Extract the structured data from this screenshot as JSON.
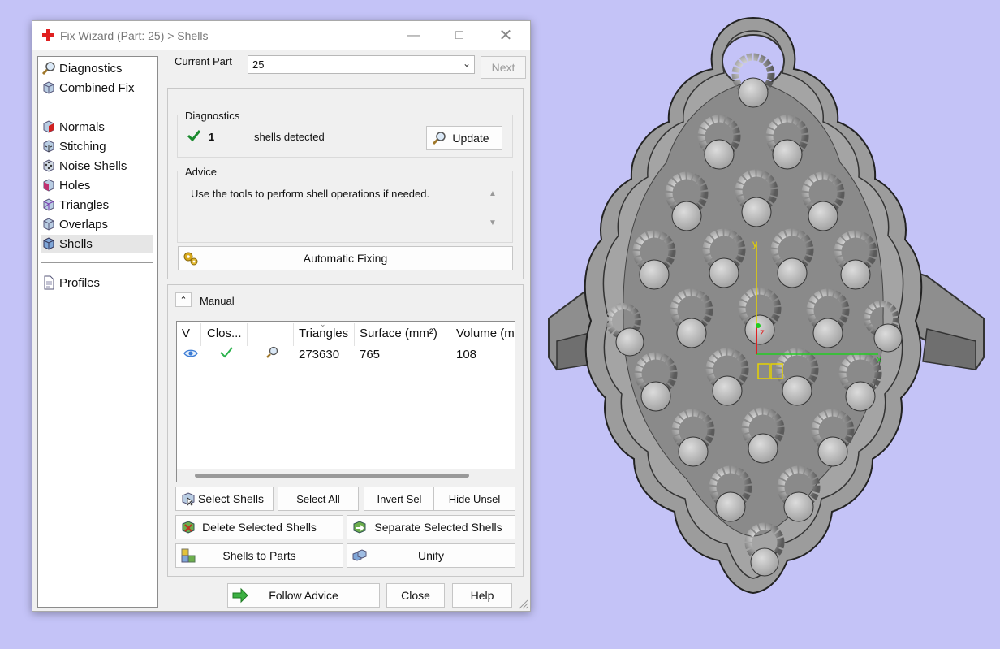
{
  "window": {
    "title": "Fix Wizard (Part: 25) > Shells"
  },
  "nav": {
    "group1": [
      {
        "label": "Diagnostics",
        "icon": "magnifier-icon"
      },
      {
        "label": "Combined Fix",
        "icon": "cube-icon"
      }
    ],
    "group2": [
      {
        "label": "Normals",
        "icon": "normals-cube-icon"
      },
      {
        "label": "Stitching",
        "icon": "stitching-cube-icon"
      },
      {
        "label": "Noise Shells",
        "icon": "noise-shells-icon"
      },
      {
        "label": "Holes",
        "icon": "holes-cube-icon"
      },
      {
        "label": "Triangles",
        "icon": "triangles-cube-icon"
      },
      {
        "label": "Overlaps",
        "icon": "overlaps-cube-icon"
      },
      {
        "label": "Shells",
        "icon": "shells-cube-icon",
        "selected": true
      }
    ],
    "group3": [
      {
        "label": "Profiles",
        "icon": "document-icon"
      }
    ]
  },
  "current_part": {
    "label": "Current Part",
    "value": "25",
    "next_label": "Next"
  },
  "diagnostics": {
    "title": "Diagnostics",
    "count": "1",
    "text": "shells detected",
    "update_label": "Update"
  },
  "advice": {
    "title": "Advice",
    "text": "Use the tools to perform shell operations if needed."
  },
  "auto_fix_label": "Automatic Fixing",
  "manual": {
    "title": "Manual",
    "table": {
      "headers": [
        "V",
        "Clos...",
        "",
        "Triangles",
        "Surface (mm²)",
        "Volume (m"
      ],
      "rows": [
        {
          "triangles": "273630",
          "surface": "765",
          "volume": "108"
        }
      ]
    },
    "buttons": {
      "select_shells": "Select Shells",
      "select_all": "Select All",
      "invert_sel": "Invert Sel",
      "hide_unsel": "Hide Unsel",
      "delete_selected": "Delete Selected Shells",
      "separate_selected": "Separate Selected Shells",
      "shells_to_parts": "Shells to Parts",
      "unify": "Unify"
    }
  },
  "footer": {
    "follow_advice": "Follow Advice",
    "close": "Close",
    "help": "Help"
  },
  "viewport": {
    "axes": {
      "x": "x",
      "y": "y",
      "z": "z"
    },
    "colors": {
      "background": "#c4c3f7",
      "model": "#9a9a9a",
      "x_axis": "#22cc22",
      "y_axis": "#e6d200",
      "z_axis": "#e02020"
    }
  }
}
